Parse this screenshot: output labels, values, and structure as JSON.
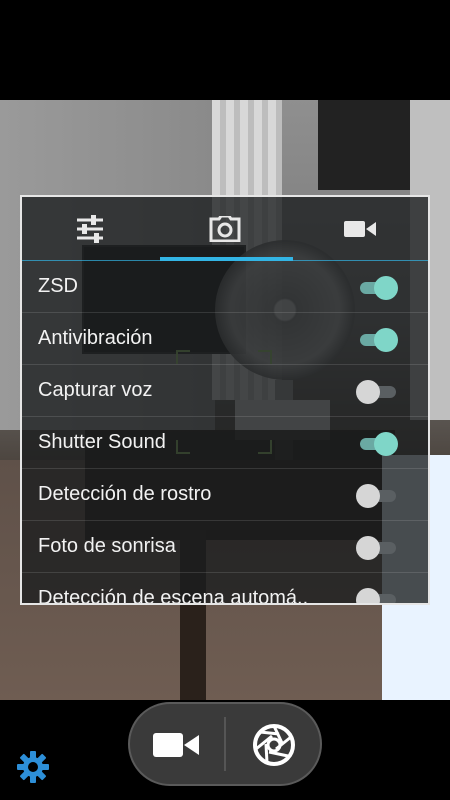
{
  "colors": {
    "accent": "#33b5e5",
    "toggle_on": "#7fd6c8",
    "toggle_off": "#d6d6d6",
    "settings_icon": "#2d8fd8"
  },
  "settings_panel": {
    "tabs": [
      {
        "name": "general-settings",
        "icon": "sliders-icon",
        "selected": false
      },
      {
        "name": "photo-settings",
        "icon": "camera-icon",
        "selected": true
      },
      {
        "name": "video-settings",
        "icon": "video-camera-icon",
        "selected": false
      }
    ],
    "rows": [
      {
        "label": "ZSD",
        "enabled": true
      },
      {
        "label": "Antivibración",
        "enabled": true
      },
      {
        "label": "Capturar voz",
        "enabled": false
      },
      {
        "label": "Shutter Sound",
        "enabled": true
      },
      {
        "label": "Detección de rostro",
        "enabled": false
      },
      {
        "label": "Foto de sonrisa",
        "enabled": false
      },
      {
        "label": "Detección de escena automá..",
        "enabled": false
      }
    ]
  },
  "controls": {
    "video_mode_icon": "video-camera-icon",
    "shutter_icon": "shutter-icon",
    "settings_icon": "gear-icon"
  }
}
